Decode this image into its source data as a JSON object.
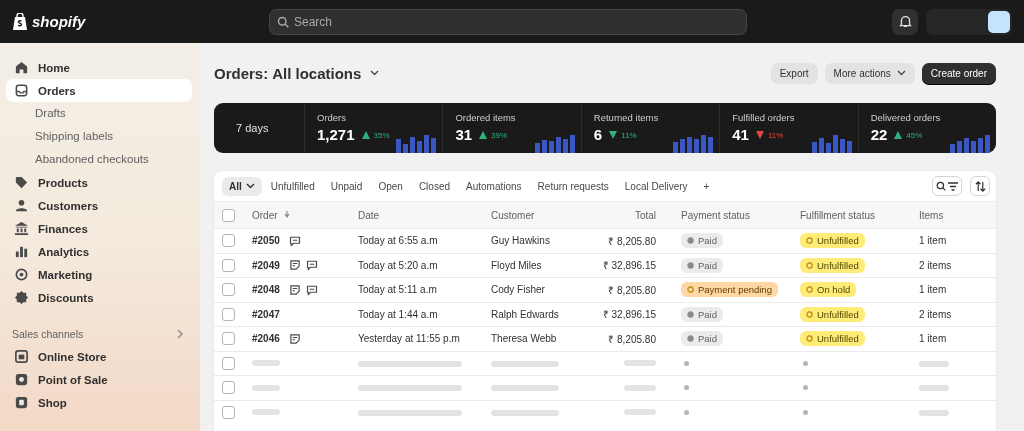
{
  "topbar": {
    "logo": "shopify",
    "search": {
      "placeholder": "Search"
    }
  },
  "sidebar": {
    "items": [
      {
        "label": "Home",
        "selected": false
      },
      {
        "label": "Orders",
        "selected": true,
        "children": [
          {
            "label": "Drafts",
            "selected": false
          },
          {
            "label": "Shipping labels",
            "selected": false
          },
          {
            "label": "Abandoned checkouts",
            "selected": false
          }
        ]
      },
      {
        "label": "Products",
        "selected": false
      },
      {
        "label": "Customers",
        "selected": false
      },
      {
        "label": "Finances",
        "selected": false
      },
      {
        "label": "Analytics",
        "selected": false
      },
      {
        "label": "Marketing",
        "selected": false
      },
      {
        "label": "Discounts",
        "selected": false
      }
    ],
    "sales_channels": {
      "title": "Sales channels",
      "items": [
        {
          "label": "Online Store",
          "selected": false
        },
        {
          "label": "Point of Sale",
          "selected": false
        },
        {
          "label": "Shop",
          "selected": false
        }
      ]
    }
  },
  "page": {
    "title": "Orders:",
    "location": "All locations",
    "buttons": [
      {
        "label": "Export",
        "kind": "secondary"
      },
      {
        "label": "More actions",
        "kind": "menu"
      },
      {
        "label": "Create order",
        "kind": "primary"
      }
    ]
  },
  "stats": {
    "period": "7 days",
    "items": [
      {
        "label": "Orders",
        "value": "1,271",
        "change": "35%",
        "kind": "up",
        "color": "#2fb37a"
      },
      {
        "label": "Ordered items",
        "value": "31",
        "change": "39%",
        "kind": "up",
        "color": "#2fb37a"
      },
      {
        "label": "Returned items",
        "value": "6",
        "change": "11%",
        "kind": "down",
        "color": "#2fb37a"
      },
      {
        "label": "Fulfilled orders",
        "value": "41",
        "change": "11%",
        "kind": "down",
        "color": "#e2483d"
      },
      {
        "label": "Delivered orders",
        "value": "22",
        "change": "45%",
        "kind": "up",
        "color": "#2fb37a"
      }
    ]
  },
  "table": {
    "tabs": [
      {
        "label": "All",
        "selected": true
      },
      {
        "label": "Unfulfilled",
        "selected": false
      },
      {
        "label": "Unpaid",
        "selected": false
      },
      {
        "label": "Open",
        "selected": false
      },
      {
        "label": "Closed",
        "selected": false
      },
      {
        "label": "Automations",
        "selected": false
      },
      {
        "label": "Return requests",
        "selected": false
      },
      {
        "label": "Local Delivery",
        "selected": false
      }
    ],
    "add_tab": "+",
    "select_all": {
      "checked": false
    },
    "columns": [
      "Order",
      "Date",
      "Customer",
      "Total",
      "Payment status",
      "Fulfillment status",
      "Items"
    ],
    "rows": [
      {
        "kind": "order",
        "checked": false,
        "order": "#2050",
        "note": false,
        "comment": true,
        "date": "Today at 6:55 a.m",
        "customer": "Guy Hawkins",
        "total": "₹ 8,205.80",
        "payment": {
          "label": "Paid",
          "kind": "paid"
        },
        "fulfillment": {
          "label": "Unfulfilled",
          "kind": "attention"
        },
        "items": "1 item"
      },
      {
        "kind": "order",
        "checked": false,
        "order": "#2049",
        "note": true,
        "comment": true,
        "date": "Today at 5:20 a.m",
        "customer": "Floyd Miles",
        "total": "₹ 32,896.15",
        "payment": {
          "label": "Paid",
          "kind": "paid"
        },
        "fulfillment": {
          "label": "Unfulfilled",
          "kind": "attention"
        },
        "items": "2 items"
      },
      {
        "kind": "order",
        "checked": false,
        "order": "#2048",
        "note": true,
        "comment": true,
        "date": "Today at 5:11 a.m",
        "customer": "Cody Fisher",
        "total": "₹ 8,205.80",
        "payment": {
          "label": "Payment pending",
          "kind": "pending"
        },
        "fulfillment": {
          "label": "On hold",
          "kind": "attention"
        },
        "items": "1 item"
      },
      {
        "kind": "order",
        "checked": false,
        "order": "#2047",
        "note": false,
        "comment": false,
        "date": "Today at 1:44 a.m",
        "customer": "Ralph Edwards",
        "total": "₹ 32,896.15",
        "payment": {
          "label": "Paid",
          "kind": "paid"
        },
        "fulfillment": {
          "label": "Unfulfilled",
          "kind": "attention"
        },
        "items": "2 items"
      },
      {
        "kind": "order",
        "checked": false,
        "order": "#2046",
        "note": true,
        "comment": false,
        "date": "Yesterday at 11:55 p.m",
        "customer": "Theresa Webb",
        "total": "₹ 8,205.80",
        "payment": {
          "label": "Paid",
          "kind": "paid"
        },
        "fulfillment": {
          "label": "Unfulfilled",
          "kind": "attention"
        },
        "items": "1 item"
      },
      {
        "kind": "skeleton",
        "checked": false
      },
      {
        "kind": "skeleton",
        "checked": false
      },
      {
        "kind": "skeleton",
        "checked": false
      }
    ]
  }
}
